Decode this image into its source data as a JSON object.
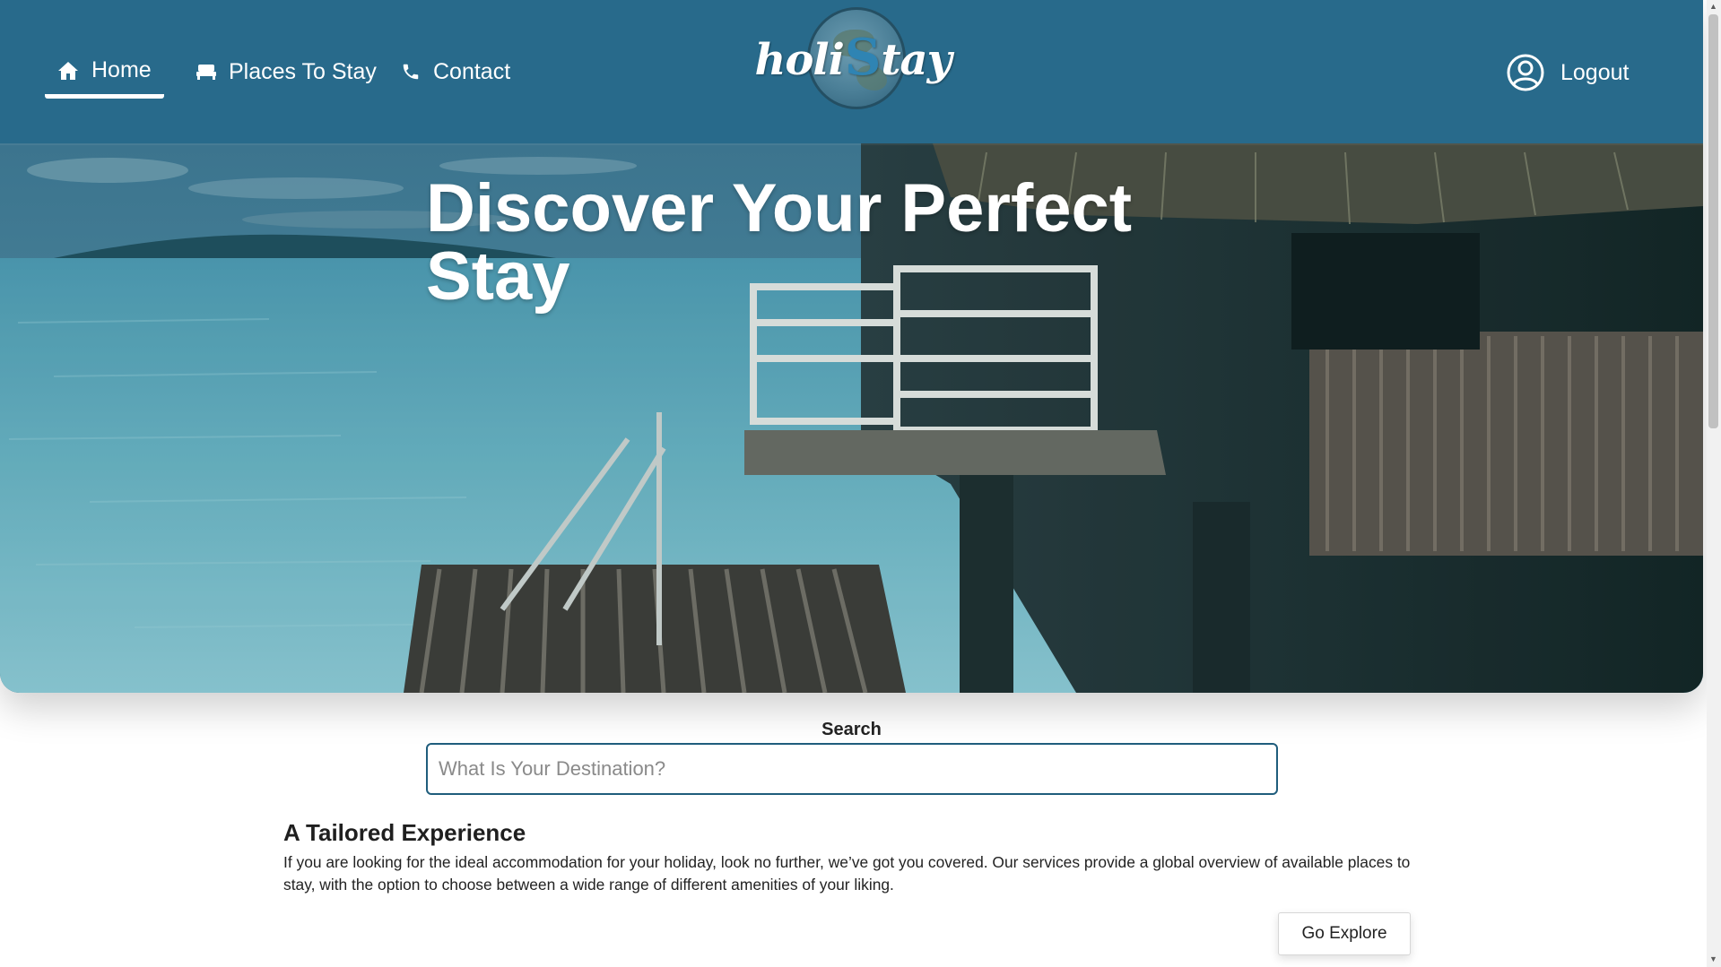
{
  "nav": {
    "home_label": "Home",
    "places_label": "Places To Stay",
    "contact_label": "Contact",
    "logout_label": "Logout",
    "active": "home"
  },
  "logo": {
    "text_left": "holi",
    "text_s": "S",
    "text_right": "tay"
  },
  "hero": {
    "title": "Discover Your Perfect Stay"
  },
  "search": {
    "label": "Search",
    "placeholder": "What Is Your Destination?",
    "value": ""
  },
  "intro": {
    "title": "A Tailored Experience",
    "body": "If you are looking for the ideal accommodation for your holiday, look no further, we’ve got you covered. Our services provide a global overview of available places to stay, with the option to choose between a wide range of different amenities of your liking."
  },
  "explore": {
    "label": "Go Explore"
  },
  "colors": {
    "nav_bg": "#286a8b",
    "accent": "#1f5d7c",
    "text": "#222222"
  }
}
